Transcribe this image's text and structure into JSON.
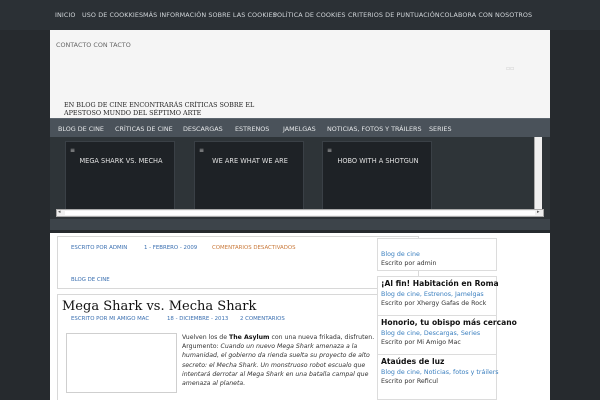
{
  "top_nav": [
    "INICIO",
    "USO DE COOKKIES",
    "MÁS INFORMACIÓN SOBRE LAS COOKIES",
    "POLÍTICA DE COOKIES",
    "CRITERIOS DE PUNTUACIÓN",
    "COLABORA CON NOSOTROS"
  ],
  "header": {
    "contact": "CONTACTO CON TACTO",
    "tagline": "EN BLOG DE CINE ENCONTRARÁS CRÍTICAS SOBRE EL APESTOSO MUNDO DEL SÉPTIMO ARTE"
  },
  "cat_nav": [
    "BLOG DE CINE",
    "CRÍTICAS DE CINE",
    "DESCARGAS",
    "ESTRENOS",
    "JAMELGAS",
    "NOTICIAS, FOTOS Y TRÁILERS",
    "SERIES"
  ],
  "slider": {
    "bullet": "≡",
    "slides": [
      "MEGA SHARK VS. MECHA",
      "WE ARE WHAT WE ARE",
      "HOBO WITH A SHOTGUN"
    ]
  },
  "post1": {
    "author": "ESCRITO POR ADMIN",
    "date": "1 - FEBRERO - 2009",
    "comments": "COMENTARIOS DESACTIVADOS",
    "category": "BLOG DE CINE"
  },
  "post2": {
    "title": "Mega Shark vs. Mecha Shark",
    "author": "ESCRITO POR MI AMIGO MAC",
    "date": "18 - DICIEMBRE - 2013",
    "comments": "2 COMENTARIOS",
    "excerpt_intro": "Vuelven los de ",
    "excerpt_bold": "The Asylum",
    "excerpt_after": " con una nueva frikada, disfruten.",
    "excerpt_arg_label": "Argumento: ",
    "excerpt_arg": "Cuando un nuevo Mega Shark amenaza a la humanidad, el gobierno da rienda suelta su proyecto de alto secreto: el Mecha Shark. Un monstruoso robot escualo que intentará derrotar al Mega Shark en una batalla campal que amenaza al planeta."
  },
  "sidebar": {
    "widget1": {
      "category": "Blog de cine",
      "by": "Escrito por admin"
    },
    "widget2": {
      "title": "¡Al fin! Habitación en Roma",
      "categories": "Blog de cine, Estrenos, Jamelgas",
      "by": "Escrito por Xhergy Gafas de Rock"
    },
    "widget3": {
      "title": "Honorio, tu obispo más cercano",
      "categories": "Blog de cine, Descargas, Series",
      "by": "Escrito por Mi Amigo Mac"
    },
    "widget4": {
      "title": "Ataúdes de luz",
      "categories": "Blog de cine, Noticias, fotos y tráilers",
      "by": "Escrito por Reficul"
    }
  }
}
